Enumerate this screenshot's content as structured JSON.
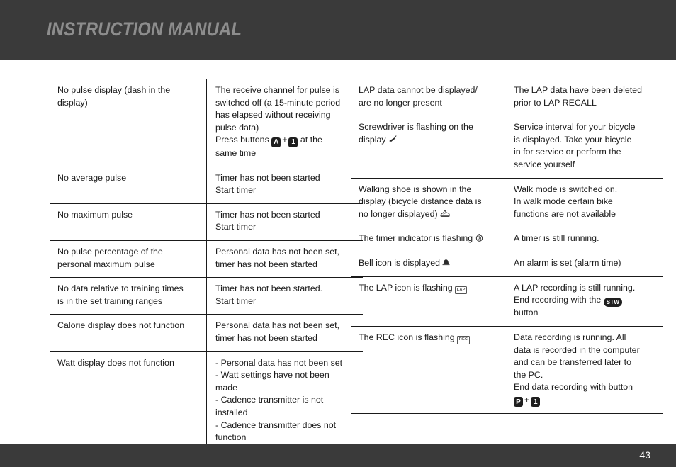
{
  "header": {
    "title": "INSTRUCTION MANUAL"
  },
  "footer": {
    "page_number": "43"
  },
  "colors": {
    "header_bg": "#3a3a3a",
    "header_text": "#8d8d8d",
    "footer_bg": "#3a3a3a",
    "footer_text": "#ffffff",
    "body_text": "#1a1a1a",
    "rule": "#1a1a1a",
    "badge_bg": "#1f1f1f",
    "badge_text": "#ffffff"
  },
  "left_table": {
    "rows": [
      {
        "symptom": [
          "No pulse display (dash in the",
          "display)"
        ],
        "cause": [
          "The receive channel for pulse is",
          "switched off (a 15-minute period",
          "has elapsed without receiving",
          "pulse data)"
        ],
        "cause_press_prefix": "Press buttons",
        "cause_btn_1": "A",
        "cause_plus": "+",
        "cause_btn_2": "1",
        "cause_press_suffix": "at the",
        "cause_press_line2": "same time"
      },
      {
        "symptom": [
          "No average pulse"
        ],
        "cause": [
          "Timer has not been started",
          "Start timer"
        ]
      },
      {
        "symptom": [
          "No maximum pulse"
        ],
        "cause": [
          "Timer has not been started",
          "Start timer"
        ]
      },
      {
        "symptom": [
          "No pulse percentage of the",
          "personal maximum pulse"
        ],
        "cause": [
          "Personal data has not been set,",
          "timer has not been started"
        ]
      },
      {
        "symptom": [
          "No data relative to training times",
          "is in the set training ranges"
        ],
        "cause": [
          "Timer has not been started.",
          "Start timer"
        ]
      },
      {
        "symptom": [
          "Calorie display does not function"
        ],
        "cause": [
          "Personal data has not been set,",
          "timer has not been started"
        ]
      },
      {
        "symptom": [
          "Watt display does not function"
        ],
        "cause": [
          "- Personal data has not been set",
          "- Watt settings have not been",
          "   made",
          "- Cadence transmitter is not",
          "   installed",
          "- Cadence transmitter does not",
          "   function"
        ]
      }
    ]
  },
  "right_table": {
    "rows": [
      {
        "symptom": [
          "LAP data cannot be displayed/",
          "are no longer present"
        ],
        "cause": [
          "The LAP data have been deleted",
          "prior to LAP RECALL"
        ]
      },
      {
        "symptom_prefix": [
          "Screwdriver is flashing on the"
        ],
        "symptom_icon_line": "display",
        "symptom_icon": "screwdriver-icon",
        "cause": [
          "Service interval for your bicycle",
          "is displayed. Take your bicycle",
          "in for service or perform the",
          "service yourself"
        ]
      },
      {
        "symptom_prefix": [
          "Walking shoe is shown in the",
          "display (bicycle distance data is"
        ],
        "symptom_icon_line": "no longer displayed)",
        "symptom_icon": "shoe-icon",
        "cause": [
          "Walk mode is switched on.",
          "In walk mode certain bike",
          "functions are not available"
        ]
      },
      {
        "symptom_icon_line": "The timer indicator is flashing",
        "symptom_icon": "timer-icon",
        "cause": [
          "A timer is still running."
        ]
      },
      {
        "symptom_icon_line": "Bell icon is displayed",
        "symptom_icon": "bell-icon",
        "cause": [
          "An alarm is set (alarm time)"
        ]
      },
      {
        "symptom_icon_line": "The LAP icon is flashing",
        "symptom_icon": "lap-icon",
        "symptom_icon_label": "LAP",
        "cause_line1": "A LAP recording is still running.",
        "cause_line2_prefix": "End recording with the",
        "cause_btn": "STW",
        "cause_line3": "button"
      },
      {
        "symptom_icon_line": "The REC icon is flashing",
        "symptom_icon": "rec-icon",
        "symptom_icon_label": "REC",
        "cause": [
          "Data recording is running. All",
          "data is recorded in the computer",
          "and can be transferred later to",
          "the PC."
        ],
        "cause_end_line": "End data recording with button",
        "cause_btn_1": "P",
        "cause_plus": "+",
        "cause_btn_2": "1"
      }
    ]
  }
}
